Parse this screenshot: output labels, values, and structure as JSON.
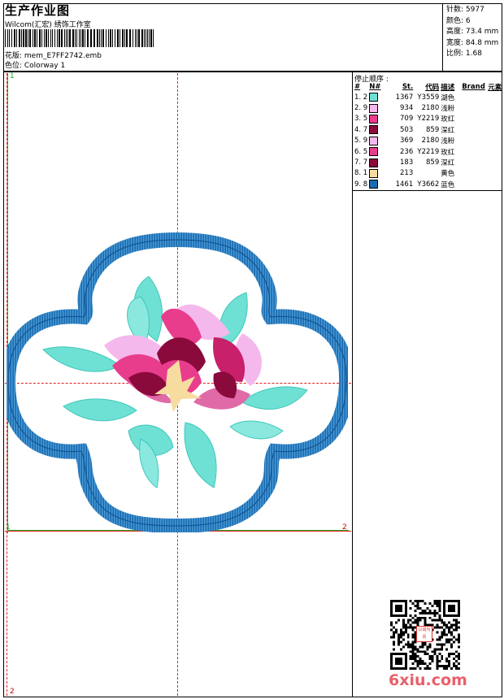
{
  "header": {
    "title": "生产作业图",
    "company": "Wilcom(汇宏) 绣饰工作室",
    "design_label": "花版:  mem_E7FF2742.emb",
    "colorway_label": "色位:  Colorway 1"
  },
  "stats": {
    "stitches": "针数: 5977",
    "colors": "颜色: 6",
    "height": "高度: 73.4 mm",
    "width": "宽度: 84.8 mm",
    "scale": "比例: 1.68"
  },
  "stop_sequence": {
    "title": "停止顺序 :",
    "columns": [
      "#",
      "N#",
      "St.",
      "代码",
      "描述",
      "Brand",
      "元素"
    ],
    "rows": [
      {
        "idx": "1. 2",
        "st": "1367",
        "code": "Y3559",
        "desc": "湖色",
        "color": "#6fe0d4"
      },
      {
        "idx": "2. 9",
        "st": "934",
        "code": "2180",
        "desc": "浅粉",
        "color": "#f5b8ec"
      },
      {
        "idx": "3. 5",
        "st": "709",
        "code": "Y2219",
        "desc": "玫红",
        "color": "#e83c8c"
      },
      {
        "idx": "4. 7",
        "st": "503",
        "code": "859",
        "desc": "深红",
        "color": "#8a0a3c"
      },
      {
        "idx": "5. 9",
        "st": "369",
        "code": "2180",
        "desc": "浅粉",
        "color": "#f5b8ec"
      },
      {
        "idx": "6. 5",
        "st": "236",
        "code": "Y2219",
        "desc": "玫红",
        "color": "#e83c8c"
      },
      {
        "idx": "7. 7",
        "st": "183",
        "code": "859",
        "desc": "深红",
        "color": "#8a0a3c"
      },
      {
        "idx": "8. 1",
        "st": "213",
        "code": "",
        "desc": "黄色",
        "color": "#f7dca0"
      },
      {
        "idx": "9. 8",
        "st": "1461",
        "code": "Y3662",
        "desc": "蓝色",
        "color": "#1a6bb0"
      }
    ]
  },
  "canvas": {
    "markers": {
      "top_left": "1",
      "mid_left": "1",
      "mid_right": "2",
      "bottom_left": "2"
    }
  },
  "watermark": "6xiu.com",
  "qr_seal_text": "以诚为贵"
}
